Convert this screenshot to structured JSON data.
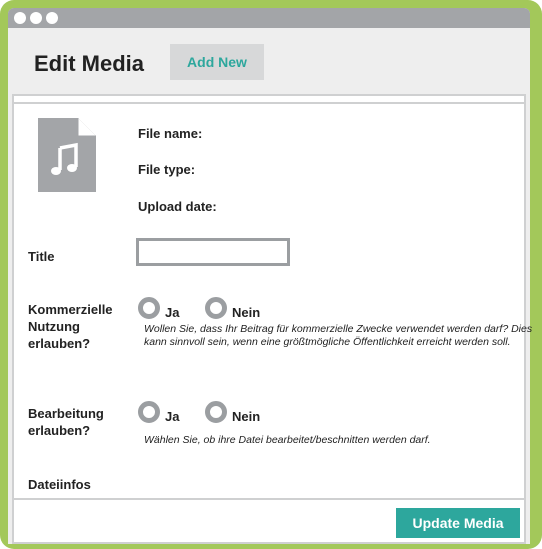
{
  "page": {
    "title": "Edit Media",
    "add_new_label": "Add New"
  },
  "file_info": {
    "file_name_label": "File name:",
    "file_type_label": "File type:",
    "upload_date_label": "Upload date:",
    "icon": "audio-file-icon"
  },
  "fields": {
    "title_label": "Title",
    "commercial_label": "Kommerzielle Nutzung erlauben?",
    "commercial_yes": "Ja",
    "commercial_no": "Nein",
    "commercial_help": "Wollen Sie, dass Ihr Beitrag für kommerzielle Zwecke verwendet werden darf? Dies kann sinnvoll sein, wenn eine größtmögliche Öffentlichkeit erreicht werden soll.",
    "editing_label": "Bearbeitung erlauben?",
    "editing_yes": "Ja",
    "editing_no": "Nein",
    "editing_help": "Wählen Sie, ob ihre Datei bearbeitet/beschnitten werden darf.",
    "file_details_label": "Dateiinfos"
  },
  "actions": {
    "update_label": "Update Media"
  },
  "colors": {
    "frame": "#a3c85a",
    "accent": "#2da79d",
    "titlebar": "#a3a5a8"
  }
}
